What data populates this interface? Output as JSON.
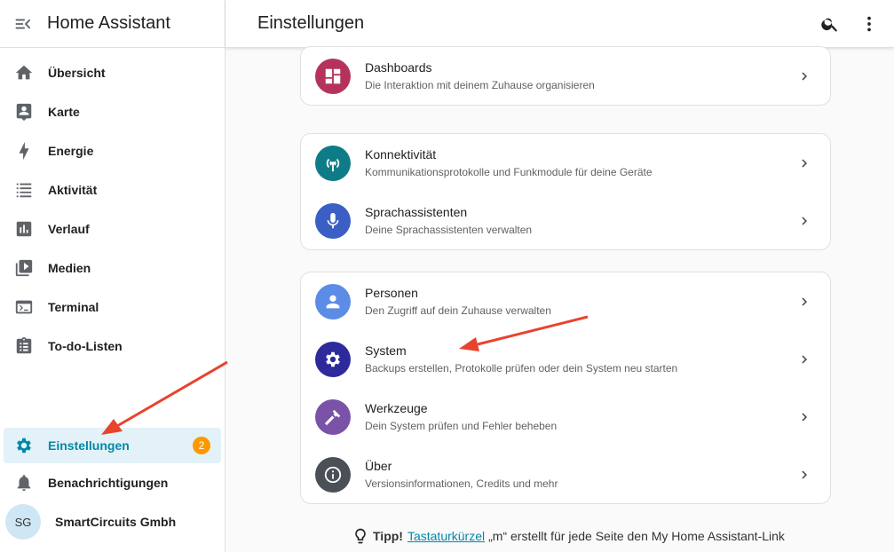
{
  "app": {
    "title": "Home Assistant"
  },
  "sidebar": {
    "items": [
      {
        "label": "Übersicht",
        "icon": "home-icon"
      },
      {
        "label": "Karte",
        "icon": "map-person-icon"
      },
      {
        "label": "Energie",
        "icon": "lightning-icon"
      },
      {
        "label": "Aktivität",
        "icon": "list-icon"
      },
      {
        "label": "Verlauf",
        "icon": "chart-bar-icon"
      },
      {
        "label": "Medien",
        "icon": "media-play-icon"
      },
      {
        "label": "Terminal",
        "icon": "terminal-icon"
      },
      {
        "label": "To-do-Listen",
        "icon": "clipboard-list-icon"
      }
    ],
    "settings": {
      "label": "Einstellungen",
      "badge": "2",
      "icon": "gear-icon"
    },
    "notifications": {
      "label": "Benachrichtigungen",
      "icon": "bell-icon"
    },
    "user": {
      "initials": "SG",
      "name": "SmartCircuits Gmbh"
    }
  },
  "header": {
    "title": "Einstellungen"
  },
  "cards": [
    {
      "rows": [
        {
          "title": "Dashboards",
          "subtitle": "Die Interaktion mit deinem Zuhause organisieren",
          "color": "#b5335a",
          "icon": "dashboard-icon"
        }
      ]
    },
    {
      "rows": [
        {
          "title": "Konnektivität",
          "subtitle": "Kommunikationsprotokolle und Funkmodule für deine Geräte",
          "color": "#0e7c86",
          "icon": "antenna-icon"
        },
        {
          "title": "Sprachassistenten",
          "subtitle": "Deine Sprachassistenten verwalten",
          "color": "#3b5fc4",
          "icon": "microphone-icon"
        }
      ]
    },
    {
      "rows": [
        {
          "title": "Personen",
          "subtitle": "Den Zugriff auf dein Zuhause verwalten",
          "color": "#5c8ce6",
          "icon": "person-icon"
        },
        {
          "title": "System",
          "subtitle": "Backups erstellen, Protokolle prüfen oder dein System neu starten",
          "color": "#2e2a9c",
          "icon": "gear-icon"
        },
        {
          "title": "Werkzeuge",
          "subtitle": "Dein System prüfen und Fehler beheben",
          "color": "#7a52a8",
          "icon": "hammer-icon"
        },
        {
          "title": "Über",
          "subtitle": "Versionsinformationen, Credits und mehr",
          "color": "#4a5056",
          "icon": "info-icon"
        }
      ]
    }
  ],
  "tip": {
    "label": "Tipp!",
    "link": "Tastaturkürzel",
    "text": "„m“ erstellt für jede Seite den My Home Assistant-Link"
  },
  "colors": {
    "accent": "#0288a8",
    "badge": "#ff9800",
    "annotation_arrow": "#e8432e"
  }
}
